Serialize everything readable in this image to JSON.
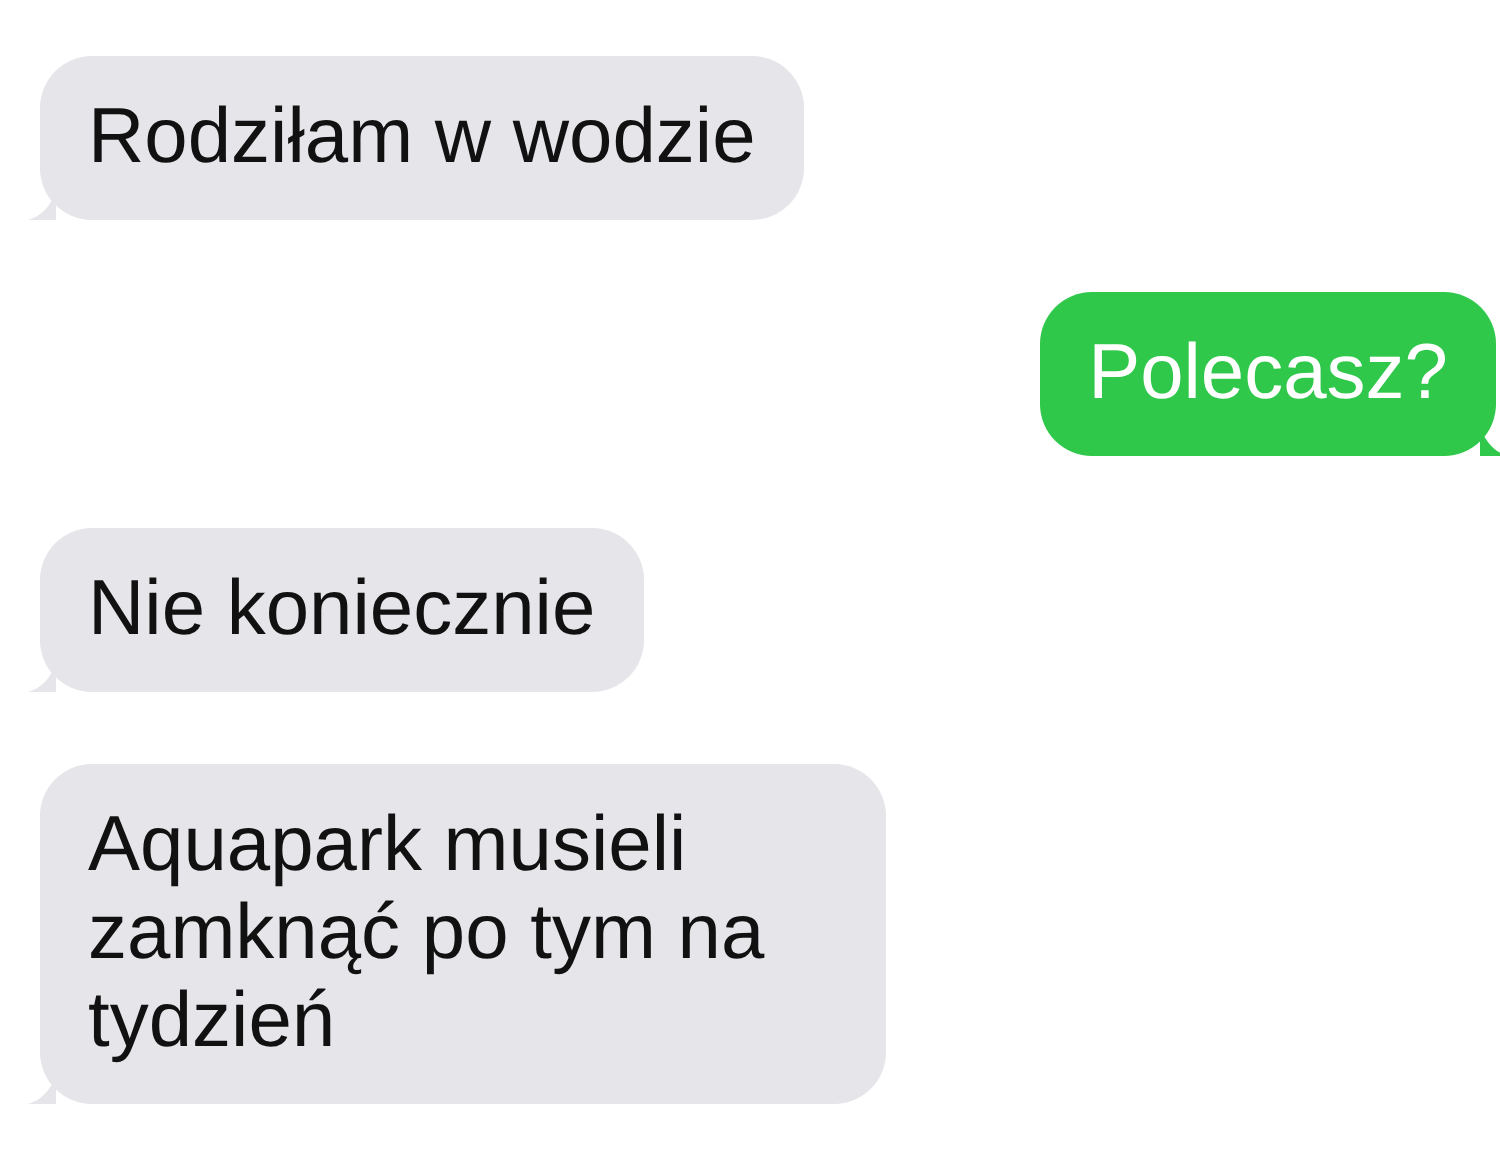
{
  "messages": [
    {
      "kind": "received",
      "text": "Rodziłam w wodzie"
    },
    {
      "kind": "sent",
      "text": "Polecasz?"
    },
    {
      "kind": "received",
      "text": "Nie koniecznie"
    },
    {
      "kind": "received",
      "text": "Aquapark musieli zamknąć po tym na tydzień"
    }
  ]
}
